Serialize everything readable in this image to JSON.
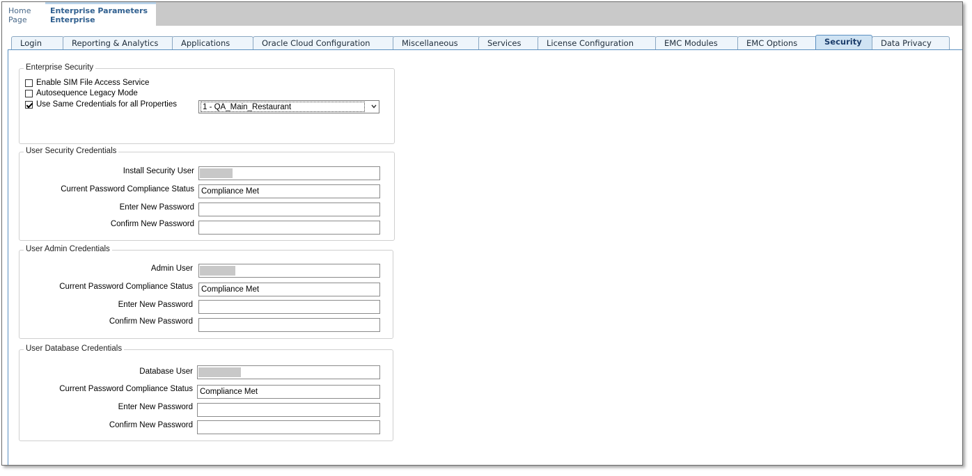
{
  "header": {
    "home_line1": "Home",
    "home_line2": "Page",
    "page_line1": "Enterprise Parameters",
    "page_line2": "Enterprise"
  },
  "tabs": [
    {
      "label": "Login"
    },
    {
      "label": "Reporting & Analytics"
    },
    {
      "label": "Applications"
    },
    {
      "label": "Oracle Cloud Configuration"
    },
    {
      "label": "Miscellaneous"
    },
    {
      "label": "Services"
    },
    {
      "label": "License Configuration"
    },
    {
      "label": "EMC Modules"
    },
    {
      "label": "EMC Options"
    },
    {
      "label": "Security",
      "active": true
    },
    {
      "label": "Data Privacy"
    }
  ],
  "enterprise_security": {
    "legend": "Enterprise Security",
    "enable_sim": {
      "label": "Enable SIM File Access Service",
      "checked": false
    },
    "autosequence": {
      "label": "Autosequence Legacy Mode",
      "checked": false
    },
    "same_credentials": {
      "label": "Use Same Credentials for all Properties",
      "checked": true
    },
    "property_select": "1 - QA_Main_Restaurant"
  },
  "user_security": {
    "legend": "User Security Credentials",
    "user_label": "Install Security User",
    "status_label": "Current Password Compliance Status",
    "status_value": "Compliance Met",
    "new_label": "Enter New Password",
    "confirm_label": "Confirm New Password"
  },
  "user_admin": {
    "legend": "User Admin Credentials",
    "user_label": "Admin User",
    "status_label": "Current Password Compliance Status",
    "status_value": "Compliance Met",
    "new_label": "Enter New Password",
    "confirm_label": "Confirm New Password"
  },
  "user_database": {
    "legend": "User Database Credentials",
    "user_label": "Database User",
    "status_label": "Current Password Compliance Status",
    "status_value": "Compliance Met",
    "new_label": "Enter New  Password",
    "confirm_label": "Confirm New Password"
  },
  "colors": {
    "active_tab": "#cfe3f3",
    "tab": "#eef5fb",
    "accent": "#2f5f8f"
  }
}
